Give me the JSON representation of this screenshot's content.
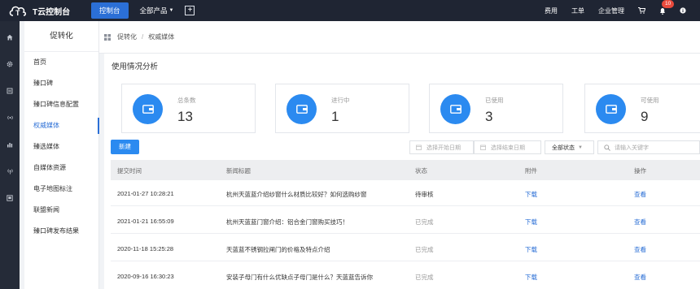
{
  "topbar": {
    "logo_text": "T云控制台",
    "console_tab": "控制台",
    "products_label": "全部产品",
    "right_links": [
      "费用",
      "工单",
      "企业管理"
    ],
    "badge_count": "10"
  },
  "rail": {
    "icons": [
      "home-icon",
      "gear-icon",
      "document-icon",
      "signal-icon",
      "bar-chart-icon",
      "broadcast-icon",
      "window-icon"
    ]
  },
  "sidebar": {
    "title": "促转化",
    "items": [
      {
        "label": "首页"
      },
      {
        "label": "臻口碑"
      },
      {
        "label": "臻口碑信息配置"
      },
      {
        "label": "权威媒体"
      },
      {
        "label": "臻选媒体"
      },
      {
        "label": "自媒体资源"
      },
      {
        "label": "电子地图标注"
      },
      {
        "label": "联盟新闻"
      },
      {
        "label": "臻口碑发布结果"
      }
    ],
    "active_index": 3
  },
  "breadcrumb": {
    "root": "促转化",
    "separator": "/",
    "current": "权威媒体"
  },
  "main": {
    "section_title": "使用情况分析",
    "stats": [
      {
        "label": "总条数",
        "value": "13"
      },
      {
        "label": "进行中",
        "value": "1"
      },
      {
        "label": "已使用",
        "value": "3"
      },
      {
        "label": "可使用",
        "value": "9"
      }
    ],
    "new_button": "新建",
    "start_date_placeholder": "选择开始日期",
    "end_date_placeholder": "选择结束日期",
    "status_select": "全部状态",
    "search_placeholder": "请输入关键字"
  },
  "table": {
    "headers": [
      "提交时间",
      "新闻标题",
      "状态",
      "附件",
      "操作"
    ],
    "rows": [
      {
        "time": "2021-01-27 10:28:21",
        "title": "杭州天蓝蓝介绍纱窗什么材质比较好？如何选购纱窗",
        "status": "待审核",
        "attachment": "下载",
        "action": "查看"
      },
      {
        "time": "2021-01-21 16:55:09",
        "title": "杭州天蓝蓝门窗介绍：铝合金门窗购买技巧！",
        "status": "已完成",
        "attachment": "下载",
        "action": "查看"
      },
      {
        "time": "2020-11-18 15:25:28",
        "title": "天蓝蓝不锈钢拉闸门的价格及特点介绍",
        "status": "已完成",
        "attachment": "下载",
        "action": "查看"
      },
      {
        "time": "2020-09-16 16:30:23",
        "title": "安装子母门有什么优缺点子母门是什么？天蓝蓝告诉你",
        "status": "已完成",
        "attachment": "下载",
        "action": "查看"
      }
    ]
  },
  "colors": {
    "topbar_bg": "#1f2533",
    "accent": "#2b8af0",
    "link": "#2b6fd6",
    "badge": "#e84a3c"
  }
}
